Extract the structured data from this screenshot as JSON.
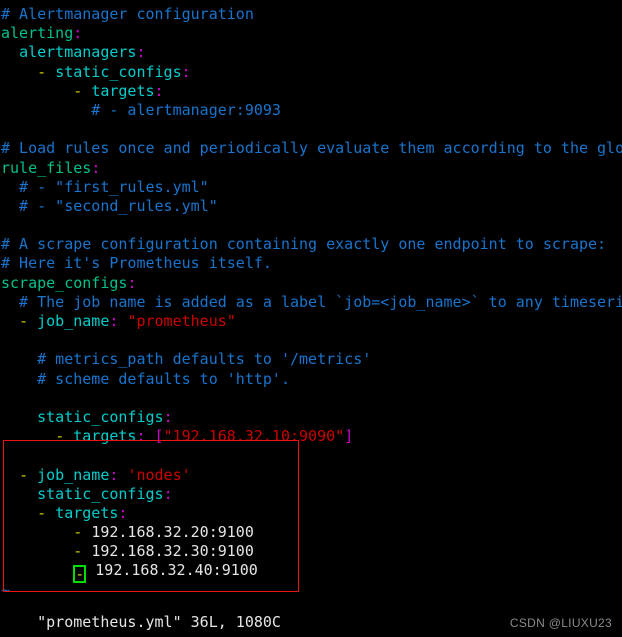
{
  "editor": {
    "app": "vim",
    "filename": "prometheus.yml",
    "status_line": "\"prometheus.yml\" 36L, 1080C",
    "tilde": "~",
    "colors": {
      "background": "#000000",
      "comment": "#1874cd",
      "top_key": "#00c18c",
      "key": "#00cdcd",
      "punctuation": "#cd00cd",
      "dash": "#cdcd00",
      "string": "#cd0000",
      "plain": "#e5e5e5",
      "cursor_outline": "#00e000",
      "annotation": "#ee1111"
    }
  },
  "annotation": {
    "name": "red-highlight-box",
    "shape": "rectangle",
    "color": "#ee1111"
  },
  "cursor": {
    "char": "-",
    "line_index": 28,
    "shape": "hollow-block"
  },
  "watermark": {
    "text": "CSDN @LIUXU23"
  },
  "lines": [
    {
      "i": 0,
      "segs": [
        {
          "t": "# Alertmanager configuration",
          "c": "c-comment"
        }
      ]
    },
    {
      "i": 1,
      "segs": [
        {
          "t": "alerting",
          "c": "c-topkey"
        },
        {
          "t": ":",
          "c": "c-colon"
        }
      ]
    },
    {
      "i": 2,
      "segs": [
        {
          "t": "  ",
          "c": "c-plain"
        },
        {
          "t": "alertmanagers",
          "c": "c-key"
        },
        {
          "t": ":",
          "c": "c-colon"
        }
      ]
    },
    {
      "i": 3,
      "segs": [
        {
          "t": "    ",
          "c": "c-plain"
        },
        {
          "t": "-",
          "c": "c-dash"
        },
        {
          "t": " ",
          "c": "c-plain"
        },
        {
          "t": "static_configs",
          "c": "c-key"
        },
        {
          "t": ":",
          "c": "c-colon"
        }
      ]
    },
    {
      "i": 4,
      "segs": [
        {
          "t": "        ",
          "c": "c-plain"
        },
        {
          "t": "-",
          "c": "c-dash"
        },
        {
          "t": " ",
          "c": "c-plain"
        },
        {
          "t": "targets",
          "c": "c-key"
        },
        {
          "t": ":",
          "c": "c-colon"
        }
      ]
    },
    {
      "i": 5,
      "segs": [
        {
          "t": "          # - alertmanager:9093",
          "c": "c-comment"
        }
      ]
    },
    {
      "i": 6,
      "segs": [
        {
          "t": "",
          "c": "c-plain"
        }
      ]
    },
    {
      "i": 7,
      "segs": [
        {
          "t": "# Load rules once and periodically evaluate them according to the glo",
          "c": "c-comment"
        }
      ]
    },
    {
      "i": 8,
      "segs": [
        {
          "t": "rule_files",
          "c": "c-topkey"
        },
        {
          "t": ":",
          "c": "c-colon"
        }
      ]
    },
    {
      "i": 9,
      "segs": [
        {
          "t": "  # - \"first_rules.yml\"",
          "c": "c-comment"
        }
      ]
    },
    {
      "i": 10,
      "segs": [
        {
          "t": "  # - \"second_rules.yml\"",
          "c": "c-comment"
        }
      ]
    },
    {
      "i": 11,
      "segs": [
        {
          "t": "",
          "c": "c-plain"
        }
      ]
    },
    {
      "i": 12,
      "segs": [
        {
          "t": "# A scrape configuration containing exactly one endpoint to scrape:",
          "c": "c-comment"
        }
      ]
    },
    {
      "i": 13,
      "segs": [
        {
          "t": "# Here it's Prometheus itself.",
          "c": "c-comment"
        }
      ]
    },
    {
      "i": 14,
      "segs": [
        {
          "t": "scrape_configs",
          "c": "c-topkey"
        },
        {
          "t": ":",
          "c": "c-colon"
        }
      ]
    },
    {
      "i": 15,
      "segs": [
        {
          "t": "  # The job name is added as a label `job=<job_name>` to any timeseri",
          "c": "c-comment"
        }
      ]
    },
    {
      "i": 16,
      "segs": [
        {
          "t": "  ",
          "c": "c-plain"
        },
        {
          "t": "-",
          "c": "c-dash"
        },
        {
          "t": " ",
          "c": "c-plain"
        },
        {
          "t": "job_name",
          "c": "c-key"
        },
        {
          "t": ":",
          "c": "c-colon"
        },
        {
          "t": " ",
          "c": "c-plain"
        },
        {
          "t": "\"prometheus\"",
          "c": "c-string"
        }
      ]
    },
    {
      "i": 17,
      "segs": [
        {
          "t": "",
          "c": "c-plain"
        }
      ]
    },
    {
      "i": 18,
      "segs": [
        {
          "t": "    # metrics_path defaults to '/metrics'",
          "c": "c-comment"
        }
      ]
    },
    {
      "i": 19,
      "segs": [
        {
          "t": "    # scheme defaults to 'http'.",
          "c": "c-comment"
        }
      ]
    },
    {
      "i": 20,
      "segs": [
        {
          "t": "",
          "c": "c-plain"
        }
      ]
    },
    {
      "i": 21,
      "segs": [
        {
          "t": "    ",
          "c": "c-plain"
        },
        {
          "t": "static_configs",
          "c": "c-key"
        },
        {
          "t": ":",
          "c": "c-colon"
        }
      ]
    },
    {
      "i": 22,
      "segs": [
        {
          "t": "      ",
          "c": "c-plain"
        },
        {
          "t": "-",
          "c": "c-dash"
        },
        {
          "t": " ",
          "c": "c-plain"
        },
        {
          "t": "targets",
          "c": "c-key"
        },
        {
          "t": ":",
          "c": "c-colon"
        },
        {
          "t": " ",
          "c": "c-plain"
        },
        {
          "t": "[",
          "c": "c-bracket"
        },
        {
          "t": "\"192.168.32.10:9090\"",
          "c": "c-string"
        },
        {
          "t": "]",
          "c": "c-bracket"
        }
      ]
    },
    {
      "i": 23,
      "segs": [
        {
          "t": "",
          "c": "c-plain"
        }
      ]
    },
    {
      "i": 24,
      "segs": [
        {
          "t": "  ",
          "c": "c-plain"
        },
        {
          "t": "-",
          "c": "c-dash"
        },
        {
          "t": " ",
          "c": "c-plain"
        },
        {
          "t": "job_name",
          "c": "c-key"
        },
        {
          "t": ":",
          "c": "c-colon"
        },
        {
          "t": " ",
          "c": "c-plain"
        },
        {
          "t": "'nodes'",
          "c": "c-string"
        }
      ]
    },
    {
      "i": 25,
      "segs": [
        {
          "t": "    ",
          "c": "c-plain"
        },
        {
          "t": "static_configs",
          "c": "c-key"
        },
        {
          "t": ":",
          "c": "c-colon"
        }
      ]
    },
    {
      "i": 26,
      "segs": [
        {
          "t": "    ",
          "c": "c-plain"
        },
        {
          "t": "-",
          "c": "c-dash"
        },
        {
          "t": " ",
          "c": "c-plain"
        },
        {
          "t": "targets",
          "c": "c-key"
        },
        {
          "t": ":",
          "c": "c-colon"
        }
      ]
    },
    {
      "i": 27,
      "segs": [
        {
          "t": "        ",
          "c": "c-plain"
        },
        {
          "t": "-",
          "c": "c-dash"
        },
        {
          "t": " ",
          "c": "c-plain"
        },
        {
          "t": "192.168.32.20:9100",
          "c": "c-plain"
        }
      ]
    },
    {
      "i": 28,
      "segs": [
        {
          "t": "        ",
          "c": "c-plain"
        },
        {
          "t": "-",
          "c": "c-dash"
        },
        {
          "t": " ",
          "c": "c-plain"
        },
        {
          "t": "192.168.32.30:9100",
          "c": "c-plain"
        }
      ]
    },
    {
      "i": 29,
      "segs": [
        {
          "t": "        ",
          "c": "c-plain"
        },
        {
          "t": "-",
          "c": "cursor"
        },
        {
          "t": " ",
          "c": "c-plain"
        },
        {
          "t": "192.168.32.40:9100",
          "c": "c-plain"
        }
      ]
    },
    {
      "i": 30,
      "segs": [
        {
          "t": "~",
          "c": "c-tilde"
        }
      ]
    }
  ]
}
